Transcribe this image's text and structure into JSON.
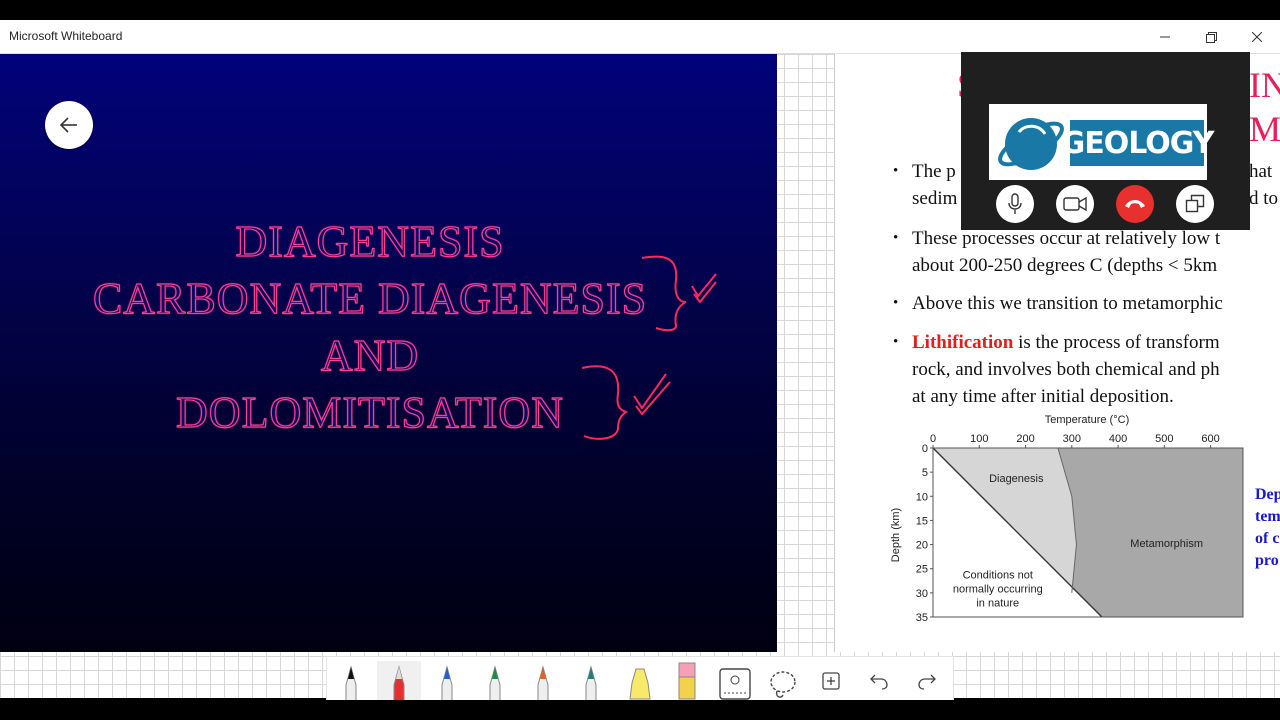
{
  "window": {
    "title": "Microsoft Whiteboard"
  },
  "slide_left": {
    "lines": [
      "DIAGENESIS",
      "CARBONATE DIAGENESIS",
      "AND",
      "DOLOMITISATION"
    ],
    "colors": {
      "text_outline": "#ff3f8f",
      "annotation": "#ff2a5a"
    }
  },
  "slide_right": {
    "heading_fragments": [
      "S",
      "IN",
      "M"
    ],
    "bullets": [
      {
        "text_a": "The p",
        "text_b": "hat",
        "line2": "sedim",
        "line2_b": "d to"
      },
      {
        "text": "These processes occur at relatively low t",
        "line2": "about 200-250 degrees C (depths < 5km"
      },
      {
        "text": "Above this we transition to metamorphic"
      },
      {
        "highlight": "Lithification",
        "text": " is the process of transform",
        "line2": "rock, and involves both chemical and ph",
        "line3": "at any time after initial deposition."
      }
    ],
    "side_text": [
      "Dep",
      "tem",
      "of c",
      "pro"
    ]
  },
  "chart_data": {
    "type": "area",
    "title": "Temperature (°C)",
    "xlabel": "Temperature (°C)",
    "ylabel": "Depth (km)",
    "x_ticks": [
      0,
      100,
      200,
      300,
      400,
      500,
      600
    ],
    "y_ticks": [
      0,
      5,
      10,
      15,
      20,
      25,
      30,
      35
    ],
    "xlim": [
      0,
      670
    ],
    "ylim": [
      0,
      35
    ],
    "regions": [
      {
        "name": "Diagenesis",
        "label": "Diagenesis"
      },
      {
        "name": "Metamorphism",
        "label": "Metamorphism"
      },
      {
        "name": "Not natural",
        "label_lines": [
          "Conditions not",
          "normally occurring",
          "in nature"
        ]
      }
    ]
  },
  "call_window": {
    "logo_text": "GEOLOGY",
    "buttons": [
      "microphone-icon",
      "video-camera-icon",
      "hang-up-icon",
      "popout-icon"
    ]
  },
  "toolbar": {
    "tools": [
      "black-pen",
      "red-pen",
      "blue-pen",
      "green-pen",
      "orange-pen",
      "teal-pen",
      "highlighter",
      "eraser",
      "ruler",
      "lasso",
      "add",
      "undo",
      "redo"
    ]
  }
}
